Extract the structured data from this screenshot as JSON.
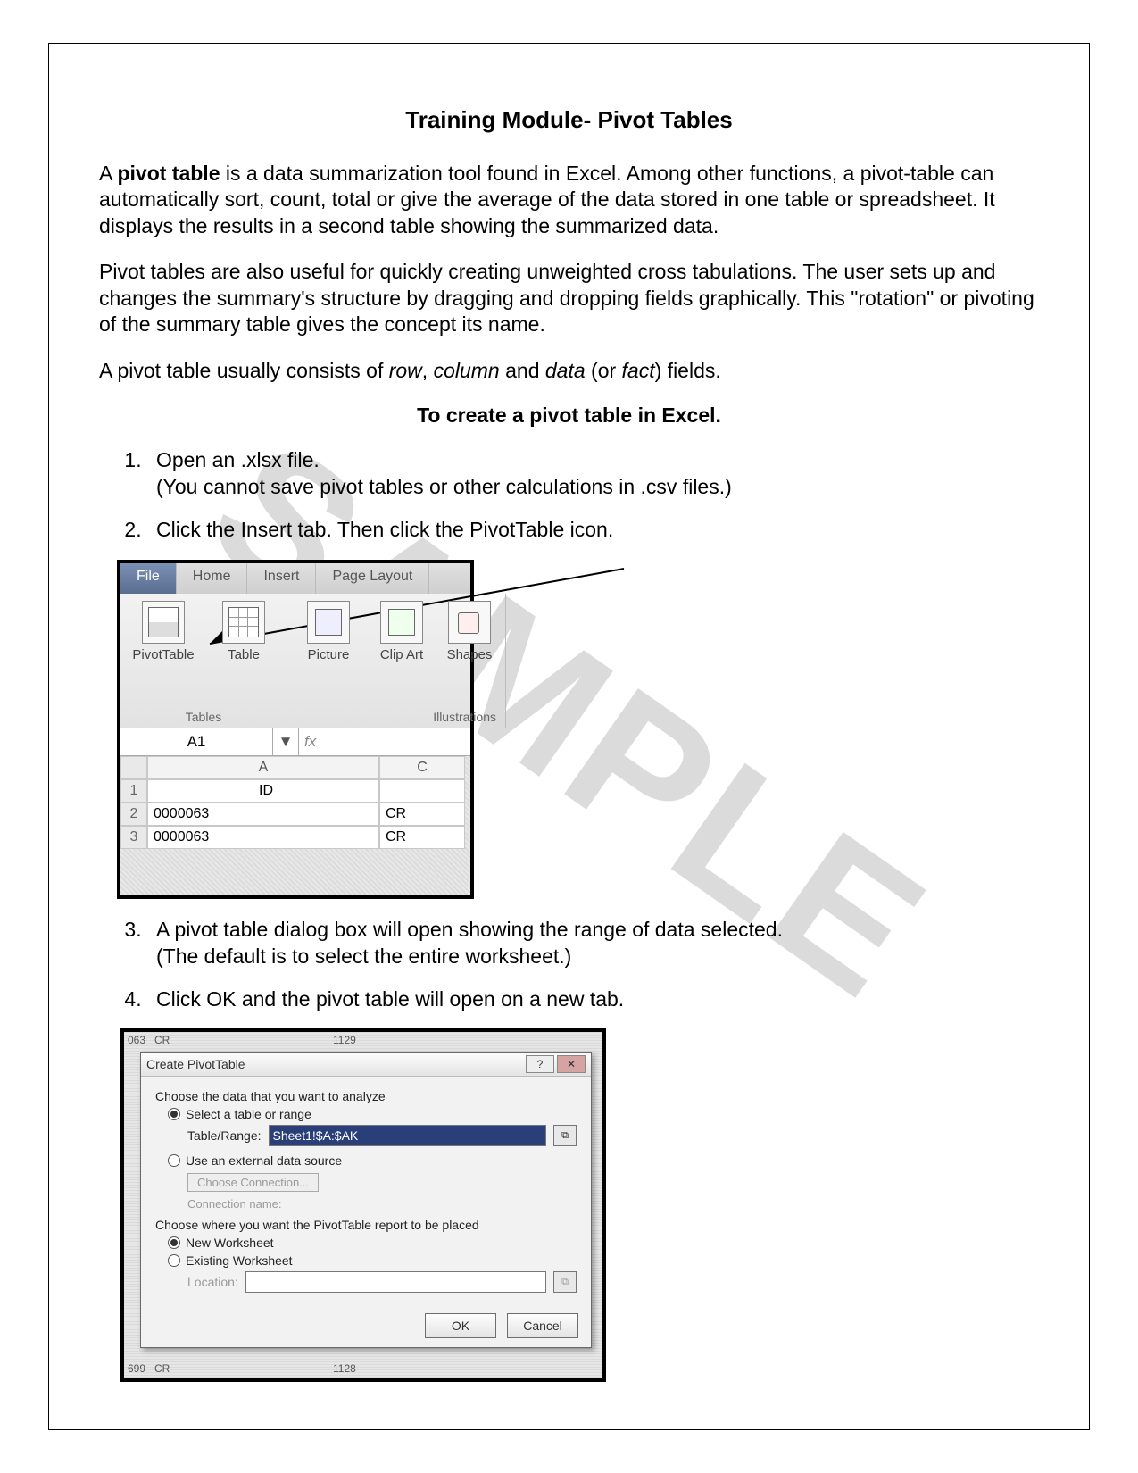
{
  "title": "Training Module- Pivot Tables",
  "watermark": "SAMPLE",
  "para1_lead_bold": "pivot table",
  "para1_before": "A ",
  "para1_after": " is a data summarization tool found in Excel. Among other functions, a pivot-table can automatically sort, count, total or give the average of the data stored in one table or spreadsheet. It displays the results in a second table showing the summarized data.",
  "para2": "Pivot tables are also useful for quickly creating unweighted cross tabulations. The user sets up and changes the summary's structure by dragging and dropping fields graphically. This \"rotation\" or pivoting of the summary table gives the concept its name.",
  "para3_before": "A pivot table usually consists of ",
  "para3_row": "row",
  "para3_sep1": ", ",
  "para3_col": "column",
  "para3_sep2": " and ",
  "para3_data": "data",
  "para3_sep3": " (or ",
  "para3_fact": "fact",
  "para3_after": ") fields.",
  "subheading": "To create a pivot table in Excel.",
  "steps": {
    "s1a": "Open an .xlsx file.",
    "s1b": "(You cannot save pivot tables or other calculations in .csv files.)",
    "s2": "Click the Insert tab. Then click the PivotTable icon.",
    "s3a": "A pivot table dialog box will open showing the range of data selected.",
    "s3b": "(The default is to select the entire worksheet.)",
    "s4": "Click OK and the pivot table will open on a new tab."
  },
  "ribbon": {
    "tabs": {
      "file": "File",
      "home": "Home",
      "insert": "Insert",
      "pagelayout": "Page Layout"
    },
    "buttons": {
      "pivottable": "PivotTable",
      "table": "Table",
      "picture": "Picture",
      "clipart": "Clip Art",
      "shapes": "Shapes"
    },
    "groups": {
      "tables": "Tables",
      "illustrations": "Illustrations"
    },
    "namebox": "A1",
    "dropdown_glyph": "▼",
    "fx": "fx",
    "headers": {
      "A": "A",
      "C": "C"
    },
    "rows_hdr": {
      "r1": "1",
      "r2": "2",
      "r3": "3"
    },
    "cells": {
      "A1": "ID",
      "A2": "0000063",
      "A3": "0000063",
      "C2": "CR",
      "C3": "CR"
    }
  },
  "dialog": {
    "title": "Create PivotTable",
    "help_glyph": "?",
    "close_glyph": "✕",
    "choose_data": "Choose the data that you want to analyze",
    "opt_select_range": "Select a table or range",
    "label_table_range": "Table/Range:",
    "table_range_value": "Sheet1!$A:$AK",
    "picker_glyph": "⧉",
    "opt_external": "Use an external data source",
    "btn_choose_conn": "Choose Connection...",
    "conn_name": "Connection name:",
    "choose_place": "Choose where you want the PivotTable report to be placed",
    "opt_new_ws": "New Worksheet",
    "opt_existing_ws": "Existing Worksheet",
    "label_location": "Location:",
    "ok": "OK",
    "cancel": "Cancel"
  },
  "bg": {
    "top": {
      "c1": "063",
      "c2": "CR",
      "c3": "1129"
    },
    "bottom": {
      "c1": "699",
      "c2": "CR",
      "c3": "1128"
    }
  }
}
